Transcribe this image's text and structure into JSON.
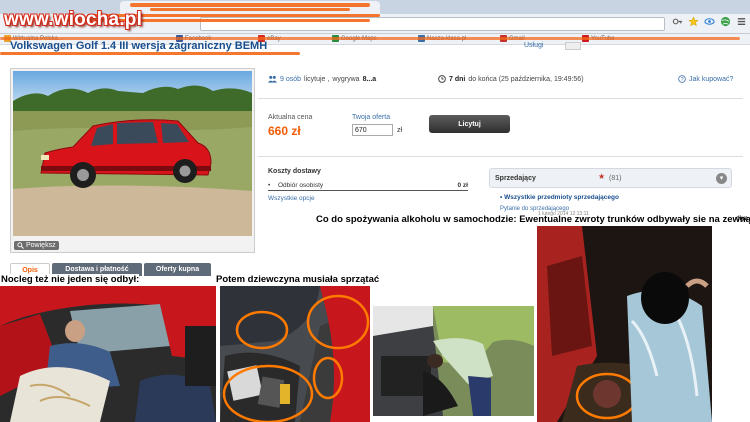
{
  "watermark": "www.wiocha.pl",
  "browser": {
    "bookmarks": [
      {
        "label": "Wirtualna Polska...",
        "color": "#e8a12a"
      },
      {
        "label": "Facebook",
        "color": "#3b5998"
      },
      {
        "label": "eBay",
        "color": "#d62a1e"
      },
      {
        "label": "Google Maps",
        "color": "#2a8c3e"
      },
      {
        "label": "Nasza-klasa.pl",
        "color": "#3a6ea8"
      },
      {
        "label": "Gmail",
        "color": "#c4302b"
      },
      {
        "label": "YouTube",
        "color": "#cc181e"
      }
    ],
    "icons": [
      "key-icon",
      "star-icon",
      "eye-icon",
      "globe-icon",
      "menu-icon"
    ]
  },
  "listing": {
    "title": "Volkswagen Golf 1.4 III wersja zagraniczny BEMH",
    "uslugi": "Usługi",
    "photo_caption": "Powiększ",
    "stats": {
      "views_count": "9 osób",
      "views_text": "licytuje ,",
      "winner_text": "wygrywa",
      "winner": "8...a",
      "days": "7 dni",
      "days_text": "do końca (25 października, 19:49:56)",
      "how_to_buy": "Jak kupować?"
    },
    "price_label": "Aktualna cena",
    "price": "660 zł",
    "offer_label": "Twoja oferta",
    "offer_value": "670",
    "currency": "zł",
    "bid_button": "Licytuj",
    "shipping": {
      "title": "Koszty dostawy",
      "rows": [
        {
          "name": "Odbiór osobisty",
          "price": "0 zł"
        }
      ],
      "all_options": "Wszystkie opcje"
    },
    "seller": {
      "label": "Sprzedający",
      "rating": "(81)",
      "all_items": "Wszystkie przedmioty sprzedającego",
      "question": "Pytanie do sprzedającego",
      "tiny_date": "1 lutego 2014 12:13:11"
    },
    "tabs": [
      "Opis",
      "Dostawa i płatność",
      "Oferty kupna"
    ]
  },
  "captions": {
    "c1": "Nocleg też nie jeden się odbył:",
    "c2": "Potem dziewczyna musiała sprzątać",
    "c3": "Co do spożywania alkoholu w samochodzie: Ewentualne zwroty trunków odbywały sie na zewnątrz!",
    "c3_trunc": "diya"
  },
  "colors": {
    "accent": "#f25c05",
    "link": "#3a6ea8",
    "car_red": "#d8141a",
    "scribble": "#f46a1c"
  }
}
